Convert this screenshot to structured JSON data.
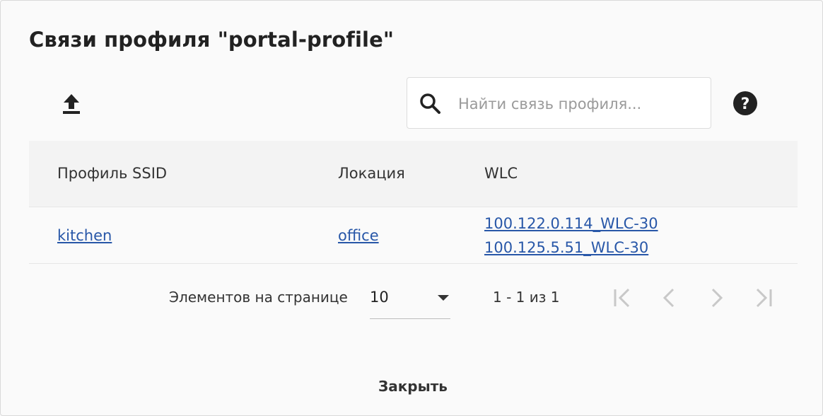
{
  "dialog": {
    "title": "Связи профиля \"portal-profile\""
  },
  "toolbar": {
    "upload_icon": "upload-icon",
    "search_icon": "search-icon",
    "search_placeholder": "Найти связь профиля...",
    "search_value": "",
    "help_icon": "help-circle-icon"
  },
  "table": {
    "columns": [
      "Профиль SSID",
      "Локация",
      "WLC"
    ],
    "rows": [
      {
        "ssid_profile": "kitchen",
        "location": "office",
        "wlc": [
          "100.122.0.114_WLC-30",
          "100.125.5.51_WLC-30"
        ]
      }
    ]
  },
  "paginator": {
    "items_per_page_label": "Элементов на странице",
    "page_size": "10",
    "range_label": "1 - 1 из 1",
    "first_icon": "first-page-icon",
    "prev_icon": "chevron-left-icon",
    "next_icon": "chevron-right-icon",
    "last_icon": "last-page-icon"
  },
  "footer": {
    "close_label": "Закрыть"
  },
  "colors": {
    "link": "#2857a8",
    "header_bg": "#f3f3f3",
    "disabled_icon": "#c8c8c8"
  }
}
